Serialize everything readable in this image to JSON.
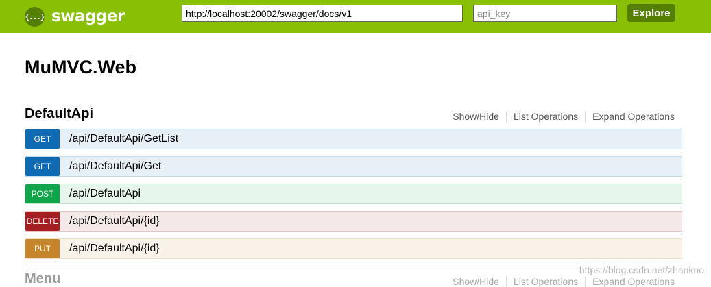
{
  "header": {
    "logo_glyph": "{...}",
    "logo_text": "swagger",
    "url_value": "http://localhost:20002/swagger/docs/v1",
    "api_key_placeholder": "api_key",
    "explore_label": "Explore",
    "colors": {
      "bar": "#89bf04",
      "button": "#547f00"
    }
  },
  "page_title": "MuMVC.Web",
  "resources": [
    {
      "name": "DefaultApi",
      "links": [
        "Show/Hide",
        "List Operations",
        "Expand Operations"
      ],
      "operations": [
        {
          "method": "GET",
          "path": "/api/DefaultApi/GetList",
          "color": "#0f6ab4"
        },
        {
          "method": "GET",
          "path": "/api/DefaultApi/Get",
          "color": "#0f6ab4"
        },
        {
          "method": "POST",
          "path": "/api/DefaultApi",
          "color": "#10a54a"
        },
        {
          "method": "DELETE",
          "path": "/api/DefaultApi/{id}",
          "color": "#a41e22"
        },
        {
          "method": "PUT",
          "path": "/api/DefaultApi/{id}",
          "color": "#c5862b"
        }
      ]
    },
    {
      "name": "Menu",
      "links": [
        "Show/Hide",
        "List Operations",
        "Expand Operations"
      ]
    }
  ],
  "watermark": "https://blog.csdn.net/zhankuo"
}
